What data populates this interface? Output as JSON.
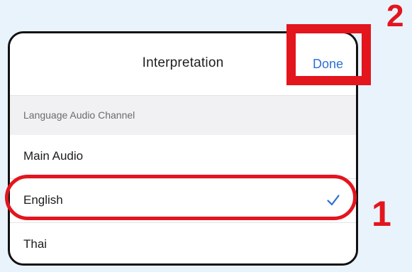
{
  "dialog": {
    "title": "Interpretation",
    "done_label": "Done"
  },
  "section": {
    "label": "Language Audio Channel"
  },
  "options": [
    {
      "label": "Main Audio",
      "selected": false
    },
    {
      "label": "English",
      "selected": true
    },
    {
      "label": "Thai",
      "selected": false
    }
  ],
  "annotations": {
    "step_1": "1",
    "step_2": "2",
    "color": "#e3151d"
  },
  "colors": {
    "accent": "#2b6fd6",
    "background": "#e9f3fb"
  },
  "icons": {
    "selected_indicator": "checkmark-icon"
  }
}
